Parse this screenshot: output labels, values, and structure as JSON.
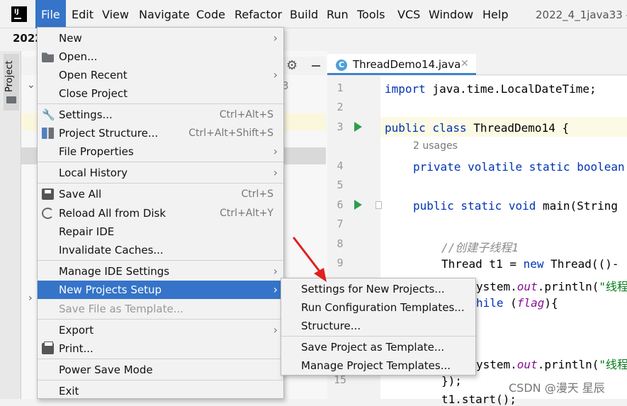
{
  "menubar": {
    "items": [
      "File",
      "Edit",
      "View",
      "Navigate",
      "Code",
      "Refactor",
      "Build",
      "Run",
      "Tools",
      "VCS",
      "Window",
      "Help"
    ],
    "window_title": "2022_4_1java33 -"
  },
  "project": {
    "title_partial": "2022",
    "tool_window_label": "Project",
    "tree_digit": "3"
  },
  "editor": {
    "tab_label": "ThreadDemo14.java",
    "tab_icon_letter": "C",
    "line_numbers": [
      "1",
      "2",
      "3",
      "4",
      "5",
      "6",
      "7",
      "8",
      "9",
      "15"
    ],
    "usages_hint": "2 usages",
    "code": {
      "l1_kw": "import",
      "l1_rest": " java.time.LocalDateTime;",
      "l3_kw": "public class",
      "l3_rest": " ThreadDemo14 {",
      "l4_kw": "private volatile static boolean",
      "l6_kw": "public static void",
      "l6_rest": " main(String",
      "l8_comment": "//创建子线程1",
      "l9_a": "Thread t1 = ",
      "l9_kw": "new",
      "l9_b": " Thread(()-",
      "l10_a": "ystem.",
      "l10_field": "out",
      "l10_b": ".println(",
      "l10_str": "\"线程",
      "l11_kw": "hile",
      "l11_a": " (",
      "l11_field": "flag",
      "l11_b": "){",
      "l14_a": "ystem.",
      "l14_field": "out",
      "l14_b": ".println(",
      "l14_str": "\"线程",
      "l15": "});",
      "l16": "t1.start();"
    }
  },
  "file_menu": {
    "items": [
      {
        "label": "New",
        "shortcut": "",
        "submenu": true
      },
      {
        "label": "Open...",
        "shortcut": "",
        "submenu": false
      },
      {
        "label": "Open Recent",
        "shortcut": "",
        "submenu": true
      },
      {
        "label": "Close Project",
        "shortcut": "",
        "submenu": false
      },
      {
        "label": "Settings...",
        "shortcut": "Ctrl+Alt+S",
        "submenu": false
      },
      {
        "label": "Project Structure...",
        "shortcut": "Ctrl+Alt+Shift+S",
        "submenu": false
      },
      {
        "label": "File Properties",
        "shortcut": "",
        "submenu": true
      },
      {
        "label": "Local History",
        "shortcut": "",
        "submenu": true
      },
      {
        "label": "Save All",
        "shortcut": "Ctrl+S",
        "submenu": false
      },
      {
        "label": "Reload All from Disk",
        "shortcut": "Ctrl+Alt+Y",
        "submenu": false
      },
      {
        "label": "Repair IDE",
        "shortcut": "",
        "submenu": false
      },
      {
        "label": "Invalidate Caches...",
        "shortcut": "",
        "submenu": false
      },
      {
        "label": "Manage IDE Settings",
        "shortcut": "",
        "submenu": true
      },
      {
        "label": "New Projects Setup",
        "shortcut": "",
        "submenu": true
      },
      {
        "label": "Save File as Template...",
        "shortcut": "",
        "submenu": false
      },
      {
        "label": "Export",
        "shortcut": "",
        "submenu": true
      },
      {
        "label": "Print...",
        "shortcut": "",
        "submenu": false
      },
      {
        "label": "Power Save Mode",
        "shortcut": "",
        "submenu": false
      },
      {
        "label": "Exit",
        "shortcut": "",
        "submenu": false
      }
    ]
  },
  "submenu": {
    "items": [
      {
        "label": "Settings for New Projects..."
      },
      {
        "label": "Run Configuration Templates..."
      },
      {
        "label": "Structure..."
      },
      {
        "label": "Save Project as Template..."
      },
      {
        "label": "Manage Project Templates..."
      }
    ]
  },
  "watermark": "CSDN @漫天 星辰",
  "colors": {
    "selection": "#3574c8",
    "annotation": "#e02020",
    "run_icon": "#2e9e4e",
    "keyword": "#0033b3"
  }
}
